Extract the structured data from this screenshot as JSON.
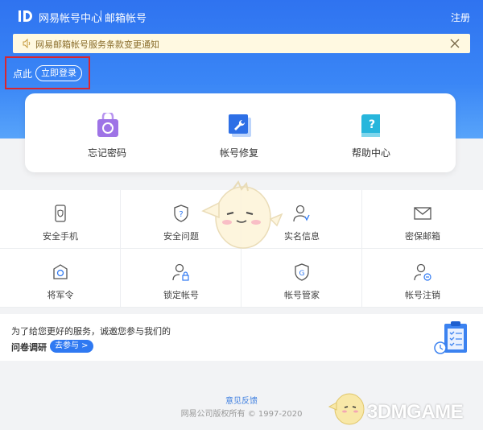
{
  "header": {
    "logo_text": "网易帐号中心",
    "logo_sub": "邮箱帐号",
    "register_label": "注册"
  },
  "notice": {
    "text": "网易邮箱帐号服务条款变更通知"
  },
  "login": {
    "hint": "点此",
    "button_label": "立即登录"
  },
  "quick_actions": [
    {
      "label": "忘记密码",
      "icon": "lock-refresh-icon"
    },
    {
      "label": "帐号修复",
      "icon": "wrench-icon"
    },
    {
      "label": "帮助中心",
      "icon": "help-book-icon"
    }
  ],
  "services": [
    {
      "label": "安全手机",
      "icon": "phone-shield-icon"
    },
    {
      "label": "安全问题",
      "icon": "shield-question-icon"
    },
    {
      "label": "实名信息",
      "icon": "user-verified-icon"
    },
    {
      "label": "密保邮箱",
      "icon": "envelope-icon"
    },
    {
      "label": "将军令",
      "icon": "token-icon"
    },
    {
      "label": "锁定帐号",
      "icon": "user-lock-icon"
    },
    {
      "label": "帐号管家",
      "icon": "shield-g-icon"
    },
    {
      "label": "帐号注销",
      "icon": "user-remove-icon"
    }
  ],
  "survey": {
    "line1": "为了给您更好的服务，诚邀您参与我们的",
    "line2": "问卷调研",
    "button_label": "去参与 >"
  },
  "footer": {
    "feedback": "意见反馈",
    "copyright": "网易公司版权所有 © 1997-2020"
  },
  "watermark": "3DMGAME",
  "colors": {
    "brand_blue": "#2f73f0",
    "notice_bg": "#fff9e1",
    "highlight_red": "#d9262f"
  }
}
